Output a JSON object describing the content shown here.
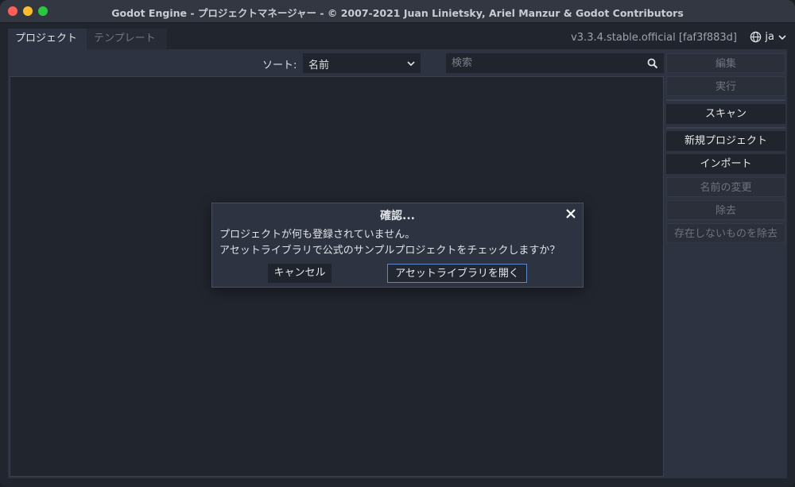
{
  "window": {
    "title": "Godot Engine - プロジェクトマネージャー - © 2007-2021 Juan Linietsky, Ariel Manzur & Godot Contributors"
  },
  "tabs": [
    {
      "label": "プロジェクト",
      "active": true
    },
    {
      "label": "テンプレート",
      "active": false
    }
  ],
  "version": "v3.3.4.stable.official [faf3f883d]",
  "language": {
    "label": "ja",
    "icon": "globe-icon"
  },
  "toolbar": {
    "sort_label": "ソート:",
    "sort_value": "名前",
    "search_placeholder": "検索",
    "search_value": ""
  },
  "sidebar": {
    "edit": "編集",
    "run": "実行",
    "scan": "スキャン",
    "new_project": "新規プロジェクト",
    "import": "インポート",
    "rename": "名前の変更",
    "remove": "除去",
    "remove_missing": "存在しないものを除去"
  },
  "dialog": {
    "title": "確認...",
    "message_line1": "プロジェクトが何も登録されていません。",
    "message_line2": "アセットライブラリで公式のサンプルプロジェクトをチェックしますか？",
    "cancel_label": "キャンセル",
    "open_label": "アセットライブラリを開く"
  },
  "colors": {
    "background": "#21252e",
    "panel": "#2d3340",
    "accent_border": "#5b86c8"
  }
}
